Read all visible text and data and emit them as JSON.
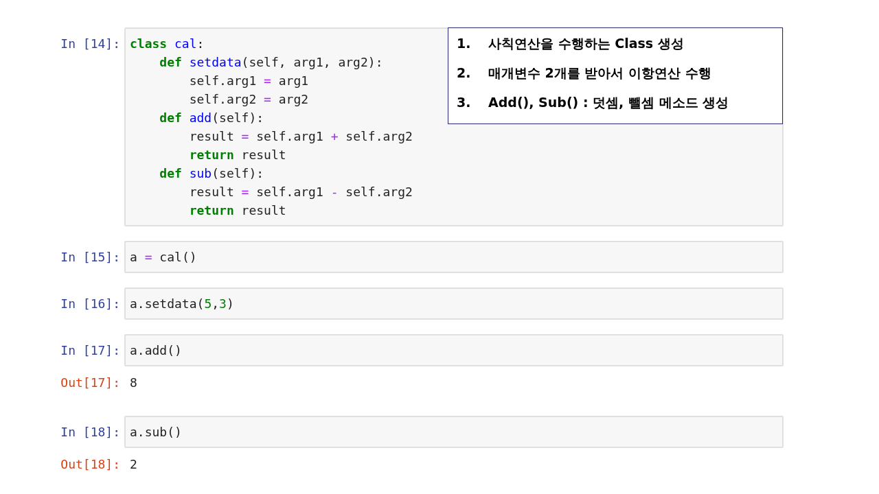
{
  "cells": [
    {
      "prompt": "In [14]:",
      "lines": [
        [
          {
            "kind": "keyword",
            "text": "class"
          },
          {
            "kind": "name",
            "text": " cal"
          },
          {
            "kind": "plain",
            "text": ":"
          }
        ],
        [
          {
            "kind": "keyword",
            "text": "    def"
          },
          {
            "kind": "name",
            "text": " setdata"
          },
          {
            "kind": "plain",
            "text": "(self, arg1, arg2):"
          }
        ],
        [
          {
            "kind": "plain",
            "text": "        self.arg1 "
          },
          {
            "kind": "operator",
            "text": "="
          },
          {
            "kind": "plain",
            "text": " arg1"
          }
        ],
        [
          {
            "kind": "plain",
            "text": "        self.arg2 "
          },
          {
            "kind": "operator",
            "text": "="
          },
          {
            "kind": "plain",
            "text": " arg2"
          }
        ],
        [
          {
            "kind": "keyword",
            "text": "    def"
          },
          {
            "kind": "name",
            "text": " add"
          },
          {
            "kind": "plain",
            "text": "(self):"
          }
        ],
        [
          {
            "kind": "plain",
            "text": "        result "
          },
          {
            "kind": "operator",
            "text": "="
          },
          {
            "kind": "plain",
            "text": " self.arg1 "
          },
          {
            "kind": "operator",
            "text": "+"
          },
          {
            "kind": "plain",
            "text": " self.arg2"
          }
        ],
        [
          {
            "kind": "keyword",
            "text": "        return"
          },
          {
            "kind": "plain",
            "text": " result"
          }
        ],
        [
          {
            "kind": "keyword",
            "text": "    def"
          },
          {
            "kind": "name",
            "text": " sub"
          },
          {
            "kind": "plain",
            "text": "(self):"
          }
        ],
        [
          {
            "kind": "plain",
            "text": "        result "
          },
          {
            "kind": "operator",
            "text": "="
          },
          {
            "kind": "plain",
            "text": " self.arg1 "
          },
          {
            "kind": "operator",
            "text": "-"
          },
          {
            "kind": "plain",
            "text": " self.arg2"
          }
        ],
        [
          {
            "kind": "keyword",
            "text": "        return"
          },
          {
            "kind": "plain",
            "text": " result"
          }
        ]
      ]
    },
    {
      "prompt": "In [15]:",
      "lines": [
        [
          {
            "kind": "plain",
            "text": "a "
          },
          {
            "kind": "operator",
            "text": "="
          },
          {
            "kind": "plain",
            "text": " cal()"
          }
        ]
      ]
    },
    {
      "prompt": "In [16]:",
      "lines": [
        [
          {
            "kind": "plain",
            "text": "a.setdata("
          },
          {
            "kind": "number",
            "text": "5"
          },
          {
            "kind": "plain",
            "text": ","
          },
          {
            "kind": "number",
            "text": "3"
          },
          {
            "kind": "plain",
            "text": ")"
          }
        ]
      ]
    },
    {
      "prompt": "In [17]:",
      "lines": [
        [
          {
            "kind": "plain",
            "text": "a.add()"
          }
        ]
      ],
      "output": {
        "prompt": "Out[17]:",
        "text": "8"
      }
    },
    {
      "prompt": "In [18]:",
      "lines": [
        [
          {
            "kind": "plain",
            "text": "a.sub()"
          }
        ]
      ],
      "output": {
        "prompt": "Out[18]:",
        "text": "2"
      }
    }
  ],
  "callout": {
    "items": [
      {
        "number": "1.",
        "text": "사칙연산을 수행하는 Class 생성"
      },
      {
        "number": "2.",
        "text": "매개변수 2개를 받아서 이항연산 수행"
      },
      {
        "number": "3.",
        "text": "Add(), Sub() : 덧셈, 뺄셈 메소드 생성"
      }
    ]
  }
}
